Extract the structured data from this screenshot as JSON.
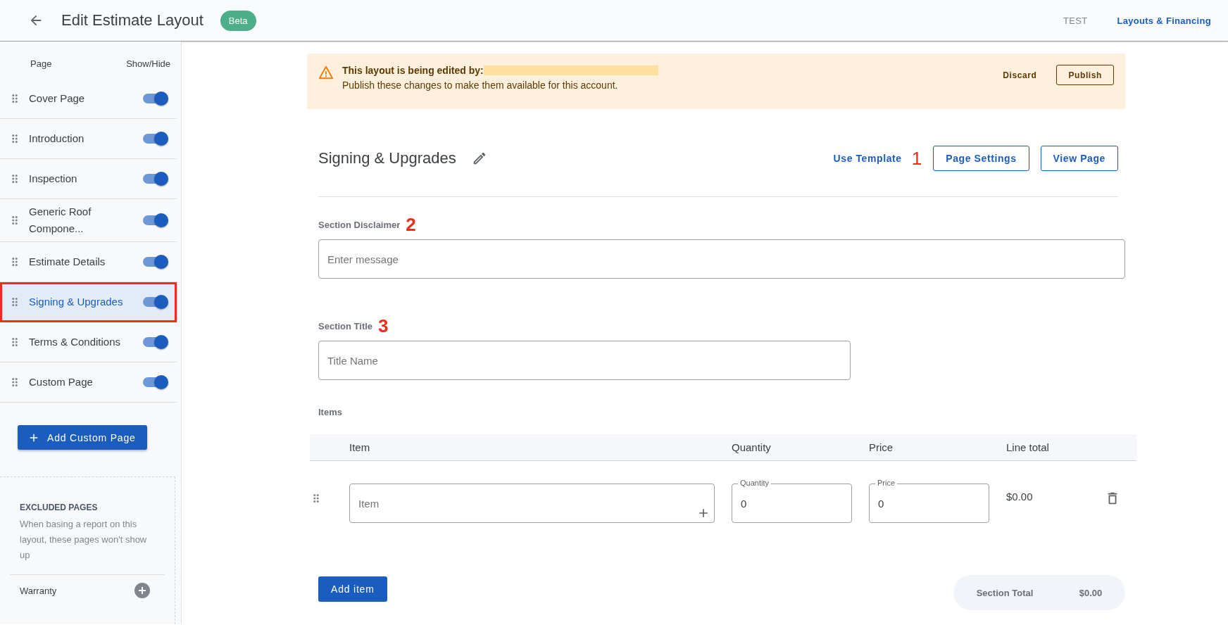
{
  "header": {
    "title": "Edit Estimate Layout",
    "badge": "Beta",
    "links": [
      {
        "label": "TEST",
        "selected": false
      },
      {
        "label": "Layouts & Financing",
        "selected": true
      }
    ]
  },
  "sidebar": {
    "columns": [
      "Page",
      "Show/Hide"
    ],
    "pages": [
      {
        "label": "Cover Page",
        "on": true,
        "selected": false,
        "highlighted": false
      },
      {
        "label": "Introduction",
        "on": true,
        "selected": false,
        "highlighted": false
      },
      {
        "label": "Inspection",
        "on": true,
        "selected": false,
        "highlighted": false
      },
      {
        "label": "Generic Roof Compone...",
        "on": true,
        "selected": false,
        "highlighted": false
      },
      {
        "label": "Estimate Details",
        "on": true,
        "selected": false,
        "highlighted": false
      },
      {
        "label": "Signing & Upgrades",
        "on": true,
        "selected": true,
        "highlighted": true
      },
      {
        "label": "Terms & Conditions",
        "on": true,
        "selected": false,
        "highlighted": false
      },
      {
        "label": "Custom Page",
        "on": true,
        "selected": false,
        "highlighted": false
      }
    ],
    "add_button": "Add Custom Page",
    "excluded": {
      "title": "EXCLUDED PAGES",
      "description": "When basing a report on this layout, these pages won't show up",
      "pages": [
        {
          "label": "Warranty"
        }
      ]
    }
  },
  "banner": {
    "title": "This layout is being edited by:",
    "editor_redacted": true,
    "message": "Publish these changes to make them available for this account.",
    "actions": [
      {
        "label": "Discard",
        "kind": "text"
      },
      {
        "label": "Publish",
        "kind": "outlined"
      }
    ]
  },
  "section": {
    "title": "Signing & Upgrades",
    "annotation": "1",
    "actions": [
      {
        "label": "Use Template",
        "kind": "text"
      },
      {
        "label": "Page Settings",
        "kind": "outlined"
      },
      {
        "label": "View Page",
        "kind": "outlined"
      }
    ],
    "disclaimer": {
      "label": "Section Disclaimer",
      "annotation": "2",
      "placeholder": "Enter message"
    },
    "section_title": {
      "label": "Section Title",
      "annotation": "3",
      "placeholder": "Title Name"
    },
    "items": {
      "label": "Items",
      "columns": [
        "Item",
        "Quantity",
        "Price",
        "Line total"
      ],
      "rows": [
        {
          "item_placeholder": "Item",
          "quantity_label": "Quantity",
          "quantity": "0",
          "price_label": "Price",
          "price": "0",
          "line_total": "$0.00"
        }
      ],
      "add_button": "Add item",
      "total_label": "Section Total",
      "total": "$0.00"
    }
  }
}
